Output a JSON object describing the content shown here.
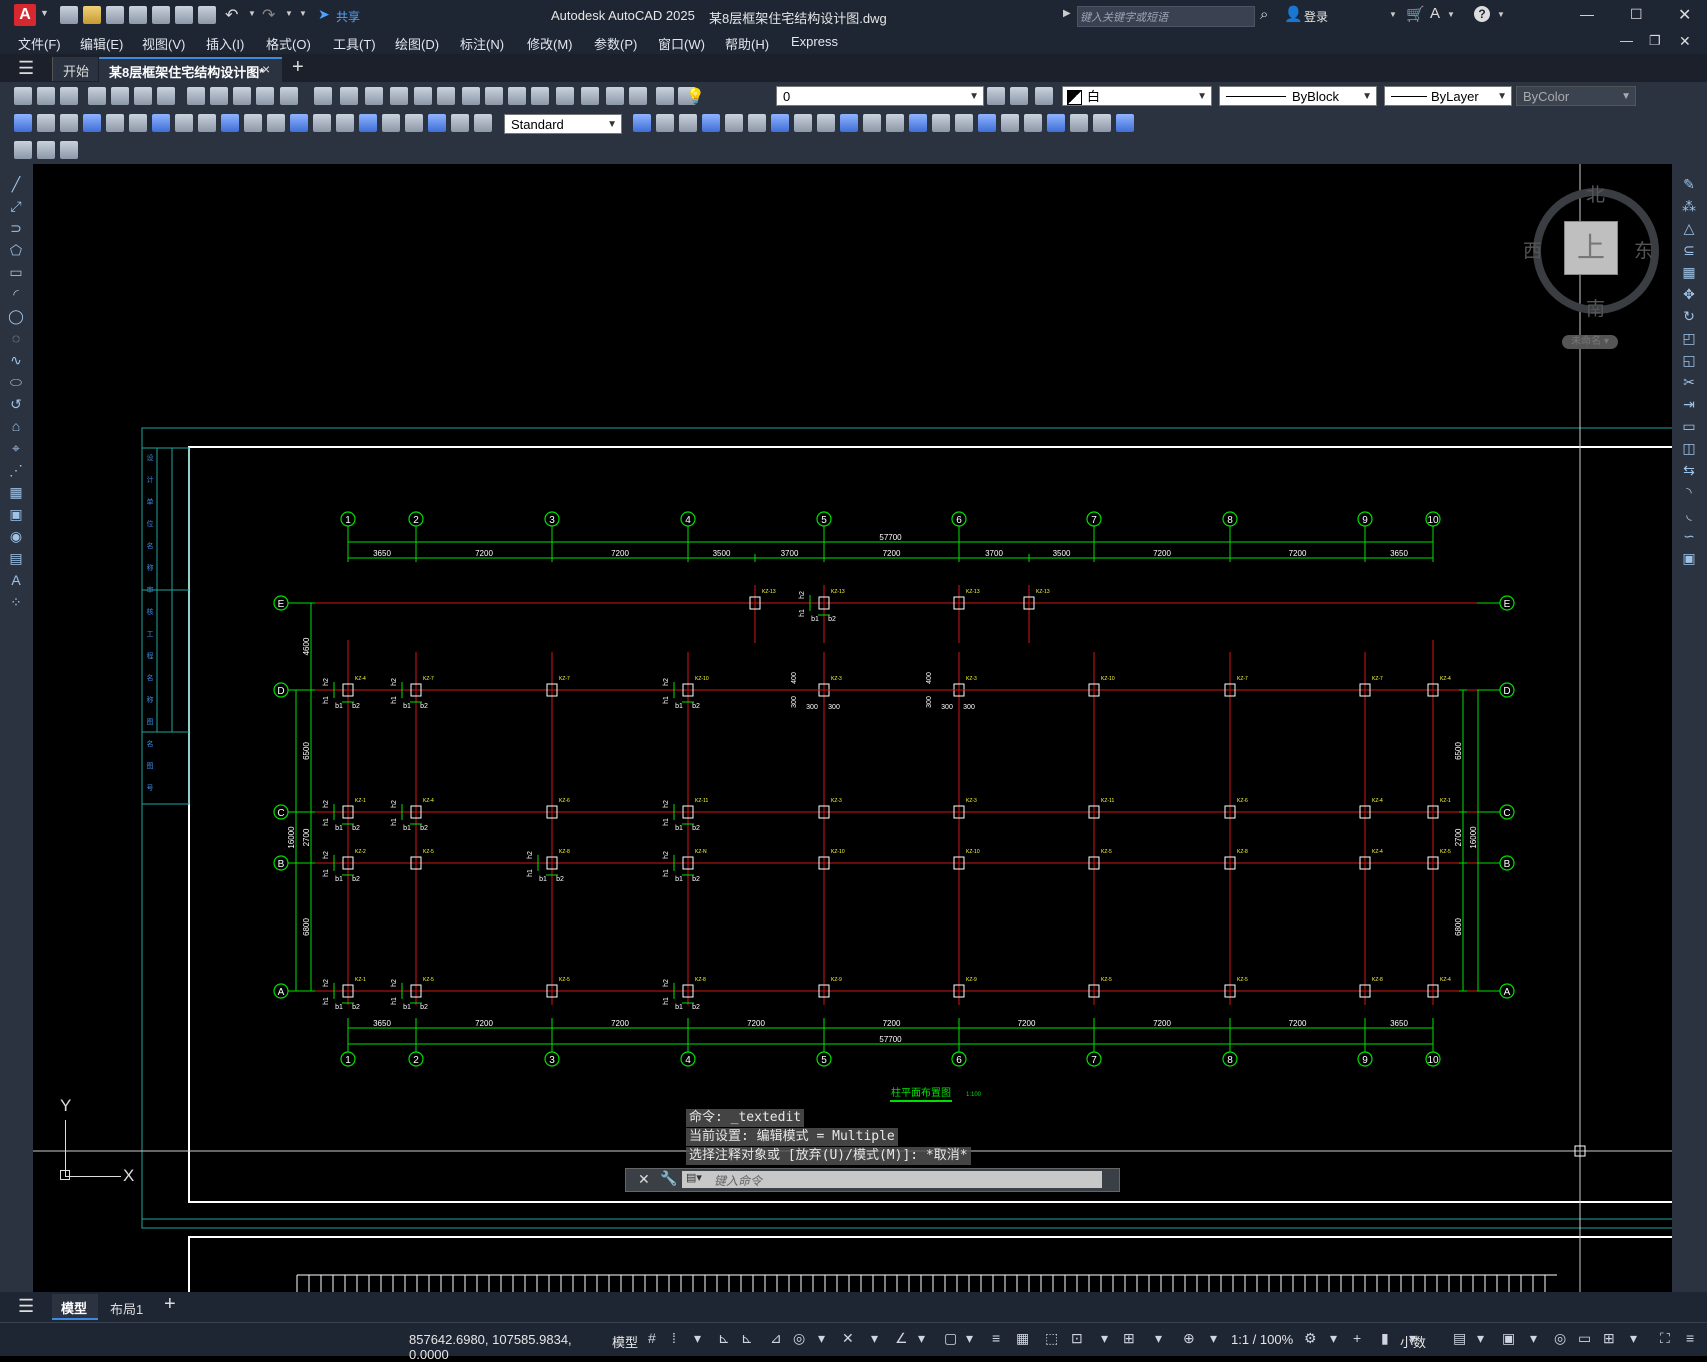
{
  "app": {
    "title": "Autodesk AutoCAD 2025",
    "document": "某8层框架住宅结构设计图.dwg",
    "search_placeholder": "键入关键字或短语",
    "login": "登录",
    "share": "共享",
    "app_letter": "A"
  },
  "menu": [
    "文件(F)",
    "编辑(E)",
    "视图(V)",
    "插入(I)",
    "格式(O)",
    "工具(T)",
    "绘图(D)",
    "标注(N)",
    "修改(M)",
    "参数(P)",
    "窗口(W)",
    "帮助(H)",
    "Express"
  ],
  "tabs": {
    "start": "开始",
    "active": "某8层框架住宅结构设计图*",
    "close": "×",
    "add": "+"
  },
  "toolbar": {
    "layer": "0",
    "color": "白",
    "linetype": "ByBlock",
    "lineweight": "ByLayer",
    "plotstyle": "ByColor",
    "textstyle": "Standard"
  },
  "viewcube": {
    "north": "北",
    "south": "南",
    "east": "东",
    "west": "西",
    "top": "上",
    "ucs": "未命名"
  },
  "drawing": {
    "col_labels": [
      "1",
      "2",
      "3",
      "4",
      "5",
      "6",
      "7",
      "8",
      "9",
      "10"
    ],
    "row_labels": [
      "E",
      "D",
      "C",
      "B",
      "A"
    ],
    "top_total": "57700",
    "bottom_total": "57700",
    "top_dims": [
      "3650",
      "7200",
      "7200",
      "3500",
      "3700",
      "7200",
      "3700",
      "3500",
      "7200",
      "7200",
      "3650"
    ],
    "bottom_dims": [
      "3650",
      "7200",
      "7200",
      "7200",
      "7200",
      "7200",
      "7200",
      "7200",
      "3650"
    ],
    "left_dims": [
      "4600",
      "6500",
      "2700",
      "6800"
    ],
    "left_total": "16000",
    "right_dims": [
      "6500",
      "2700",
      "6800"
    ],
    "right_total": "16000",
    "plan_title": "柱平面布置图",
    "plan_scale": "1:100",
    "col_tags_d": [
      "KZ-4",
      "KZ-7",
      "KZ-7",
      "KZ-10",
      "KZ-3",
      "KZ-3",
      "KZ-10",
      "KZ-7",
      "KZ-7",
      "KZ-4"
    ],
    "col_tags_c": [
      "KZ-1",
      "KZ-4",
      "KZ-6",
      "KZ-11",
      "KZ-3",
      "KZ-3",
      "KZ-11",
      "KZ-6",
      "KZ-4",
      "KZ-1"
    ],
    "col_tags_b": [
      "KZ-2",
      "KZ-5",
      "KZ-8",
      "KZ-N",
      "KZ-10",
      "KZ-10",
      "KZ-5",
      "KZ-8",
      "KZ-4",
      "KZ-5"
    ],
    "col_tags_a": [
      "KZ-1",
      "KZ-5",
      "KZ-5",
      "KZ-8",
      "KZ-9",
      "KZ-9",
      "KZ-5",
      "KZ-5",
      "KZ-8",
      "KZ-4"
    ],
    "col_tags_e": [
      "KZ-13",
      "KZ-13",
      "KZ-13",
      "KZ-13"
    ],
    "detail_labels": {
      "b1": "b1",
      "b2": "b2",
      "h1": "h1",
      "h2": "h2",
      "d300": "300",
      "d400": "400"
    },
    "sidebar_text": [
      "设",
      "计",
      "单",
      "位",
      "名",
      "称",
      "审",
      "核",
      "工",
      "程",
      "名",
      "称",
      "图",
      "名",
      "图",
      "号"
    ]
  },
  "command": {
    "line1": "命令:  _textedit",
    "line2": "当前设置: 编辑模式 = Multiple",
    "line3": "选择注释对象或 [放弃(U)/模式(M)]: *取消*",
    "input_placeholder": "键入命令"
  },
  "layouts": {
    "model": "模型",
    "layout1": "布局1",
    "add": "+"
  },
  "status": {
    "coords": "857642.6980, 107585.9834, 0.0000",
    "mode": "模型",
    "scale": "1:1 / 100%",
    "units": "小数"
  },
  "ucs": {
    "x": "X",
    "y": "Y"
  },
  "colors": {
    "grid_red": "#d31616",
    "dim_green": "#00e000",
    "frame_white": "#ffffff",
    "frame_cyan": "#1fa39a",
    "tag_yellow": "#ffff33"
  }
}
